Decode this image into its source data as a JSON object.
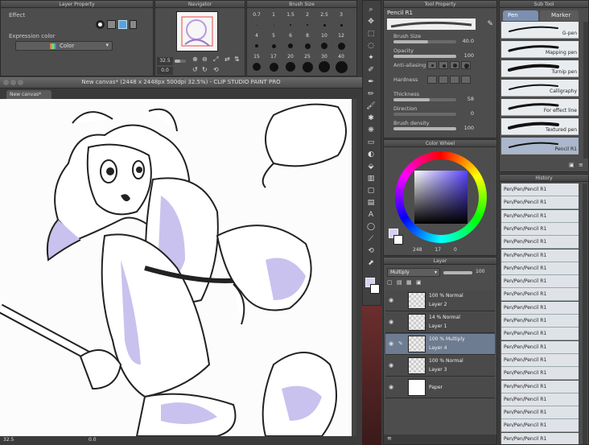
{
  "layer_property": {
    "title": "Layer Property",
    "effect_label": "Effect",
    "expression_label": "Expression color",
    "color_value": "Color"
  },
  "navigator": {
    "title": "Navigator",
    "zoom": "32.5",
    "angle": "0.0"
  },
  "brush_size_panel": {
    "title": "Brush Size",
    "sizes_row1": [
      "0.7",
      "1",
      "1.5",
      "2",
      "2.5",
      "3"
    ],
    "sizes_row2": [
      "4",
      "5",
      "6",
      "8",
      "10",
      "12"
    ],
    "sizes_row3": [
      "15",
      "17",
      "20",
      "25",
      "30",
      "40"
    ]
  },
  "canvas": {
    "window_title": "New canvas* (2448 x 2448px 500dpi 32.5%) - CLIP STUDIO PAINT PRO",
    "tab_label": "New canvas*",
    "zoom_status": "32.5",
    "angle_status": "0.0"
  },
  "tool_property": {
    "title": "Tool Property",
    "tool_name": "Pencil R1",
    "rows": [
      {
        "label": "Brush Size",
        "value": "40.0",
        "fill": 0.55
      },
      {
        "label": "Opacity",
        "value": "100",
        "fill": 1.0
      },
      {
        "label": "Anti-aliasing",
        "value": "",
        "fill": 0
      },
      {
        "label": "Hardness",
        "value": "",
        "fill": 0
      },
      {
        "label": "Thickness",
        "value": "58",
        "fill": 0.58
      },
      {
        "label": "Direction",
        "value": "0",
        "fill": 0
      },
      {
        "label": "Brush density",
        "value": "100",
        "fill": 1.0
      }
    ]
  },
  "sub_tool": {
    "title": "Sub Tool",
    "tabs": [
      "Pen",
      "Marker"
    ],
    "items": [
      "G-pen",
      "Mapping pen",
      "Turnip pen",
      "Calligraphy",
      "For effect line",
      "Textured pen",
      "Pencil R1"
    ]
  },
  "color_wheel": {
    "title": "Color Wheel",
    "h": "248",
    "s": "17",
    "v": "0"
  },
  "history": {
    "title": "History",
    "items": [
      "Pen/Pen/Pencil R1",
      "Pen/Pen/Pencil R1",
      "Pen/Pen/Pencil R1",
      "Pen/Pen/Pencil R1",
      "Pen/Pen/Pencil R1",
      "Pen/Pen/Pencil R1",
      "Pen/Pen/Pencil R1",
      "Pen/Pen/Pencil R1",
      "Pen/Pen/Pencil R1",
      "Pen/Pen/Pencil R1",
      "Pen/Pen/Pencil R1",
      "Pen/Pen/Pencil R1",
      "Pen/Pen/Pencil R1",
      "Pen/Pen/Pencil R1",
      "Pen/Pen/Pencil R1",
      "Pen/Pen/Pencil R1",
      "Pen/Pen/Pencil R1",
      "Pen/Pen/Pencil R1",
      "Pen/Pen/Pencil R1",
      "Pen/Pen/Pencil R1"
    ]
  },
  "layer_panel": {
    "title": "Layer",
    "blend_mode": "Multiply",
    "opacity": "100",
    "layers": [
      {
        "info": "100 % Normal",
        "name": "Layer 2",
        "selected": false
      },
      {
        "info": "14 % Normal",
        "name": "Layer 1",
        "selected": false
      },
      {
        "info": "100 % Multiply",
        "name": "Layer 4",
        "selected": true
      },
      {
        "info": "100 % Normal",
        "name": "Layer 3",
        "selected": false
      },
      {
        "info": "",
        "name": "Paper",
        "selected": false
      }
    ]
  },
  "colors": {
    "accent": "#7d8fb0",
    "main_color": "#d8d0f2"
  }
}
